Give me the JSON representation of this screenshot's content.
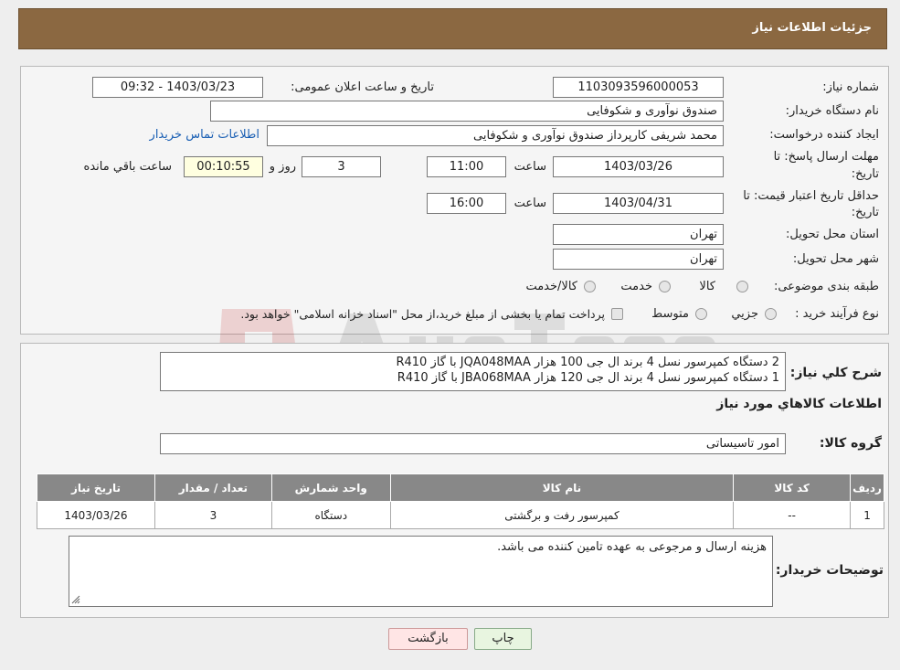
{
  "header": {
    "title": "جزئیات اطلاعات نیاز"
  },
  "form": {
    "need_number_label": "شماره نیاز:",
    "need_number": "1103093596000053",
    "announce_label": "تاریخ و ساعت اعلان عمومی:",
    "announce_value": "1403/03/23 - 09:32",
    "buyer_org_label": "نام دستگاه خریدار:",
    "buyer_org": "صندوق نوآوری و شکوفایی",
    "creator_label": "ایجاد کننده درخواست:",
    "creator": "محمد  شریفی کارپرداز صندوق نوآوری و شکوفایی",
    "contact_link": "اطلاعات تماس خریدار",
    "deadline_label_1": "مهلت ارسال پاسخ: تا",
    "deadline_label_2": "تاریخ:",
    "deadline_date": "1403/03/26",
    "time_label": "ساعت",
    "deadline_time": "11:00",
    "days_value": "3",
    "days_label": "روز و",
    "remaining_time": "00:10:55",
    "remaining_label": "ساعت باقي مانده",
    "validity_label_1": "حداقل تاریخ اعتبار قیمت: تا",
    "validity_label_2": "تاریخ:",
    "validity_date": "1403/04/31",
    "validity_time": "16:00",
    "province_label": "استان محل تحویل:",
    "province": "تهران",
    "city_label": "شهر محل تحویل:",
    "city": "تهران",
    "category_label": "طبقه بندی موضوعی:",
    "category_options": [
      "كالا",
      "خدمت",
      "كالا/خدمت"
    ],
    "process_label": "نوع فرآیند خرید :",
    "process_options": [
      "جزیي",
      "متوسط"
    ],
    "process_note": "پرداخت تمام یا بخشی از مبلغ خرید،از محل \"اسناد خزانه اسلامی\" خواهد بود."
  },
  "details": {
    "summary_label": "شرح کلي نياز:",
    "summary_line_1": "2 دستگاه کمپرسور نسل 4 برند ال جی 100 هزار JQA048MAA با گاز R410",
    "summary_line_2": "1 دستگاه کمپرسور نسل 4 برند ال جی 120 هزار JBA068MAA با گاز R410",
    "goods_info_title": "اطلاعات کالاهاي مورد نياز",
    "group_label": "گروه کالا:",
    "group_value": "امور تاسیساتی",
    "table": {
      "headers": [
        "ردیف",
        "کد کالا",
        "نام کالا",
        "واحد شمارش",
        "تعداد / مقدار",
        "تاریخ نیاز"
      ],
      "rows": [
        [
          "1",
          "--",
          "کمپرسور رفت و برگشتی",
          "دستگاه",
          "3",
          "1403/03/26"
        ]
      ]
    },
    "buyer_notes_label": "توضیحات خریدار:",
    "buyer_notes": "هزینه ارسال و مرجوعی به عهده تامین کننده می باشد."
  },
  "buttons": {
    "print": "چاپ",
    "back": "بازگشت"
  },
  "colors": {
    "header": "#8b6841",
    "table_header": "#888888",
    "link": "#1a5fb4"
  }
}
